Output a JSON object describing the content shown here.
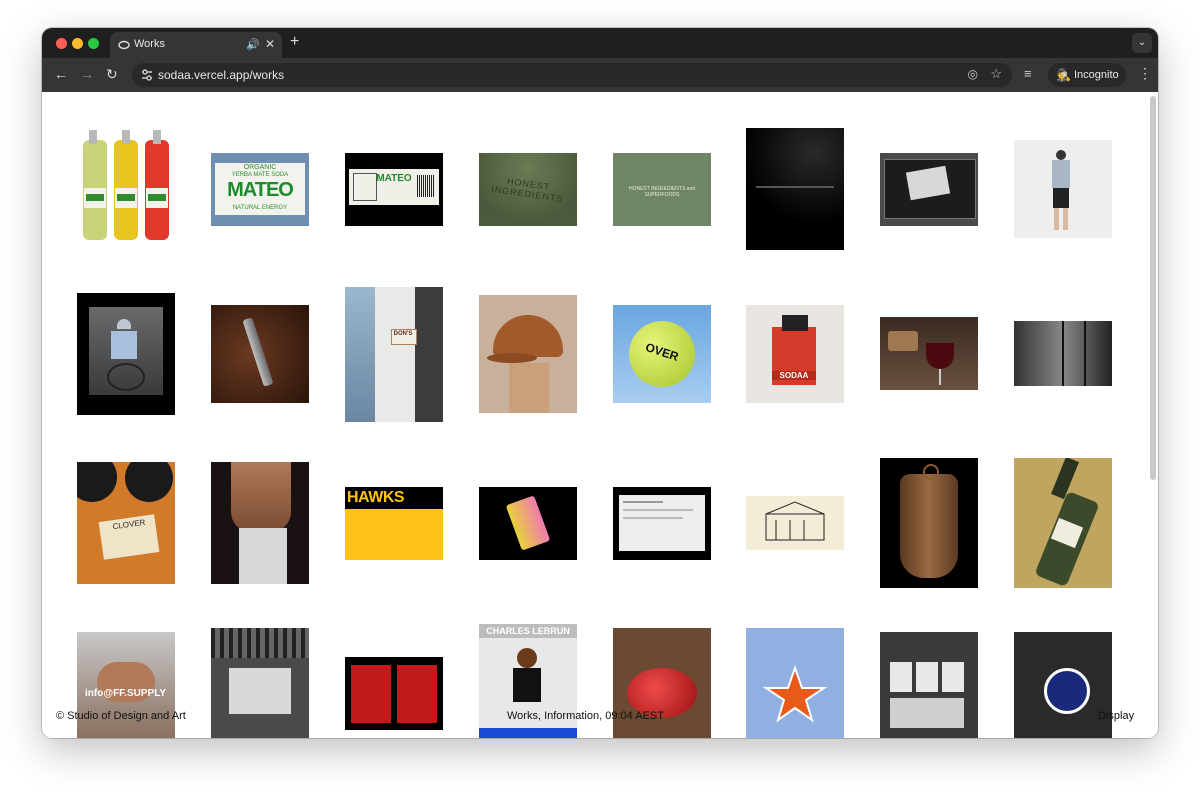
{
  "browser": {
    "tab_title": "Works",
    "url": "sodaa.vercel.app/works",
    "profile_label": "Incognito"
  },
  "tiles": {
    "mateo_label_1": "ORGANIC",
    "mateo_label_2": "YERBA MATE SODA",
    "mateo_brand": "MATEO",
    "mateo_label_3": "NATURAL ENERGY",
    "cap_text": "HONEST INGREDIENTS",
    "green_banner": "HONEST INGREDIENTS and SUPERFOODS",
    "dons_sign": "DON'S",
    "tennis_text": "OVER",
    "sodaa_box": "SODAA",
    "hawks": "HAWKS",
    "clover": "CLOVER",
    "ff_supply": "info@FF.SUPPLY",
    "charles": "CHARLES LEBRUN"
  },
  "footer": {
    "left": "© Studio of Design and Art",
    "mid": "Works, Information, 09:04 AEST",
    "right": "Display"
  }
}
